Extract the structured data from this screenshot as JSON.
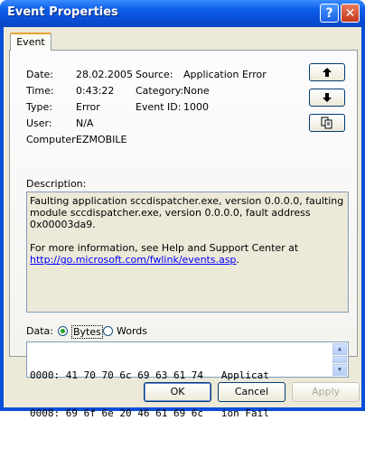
{
  "window": {
    "title": "Event Properties",
    "help_label": "?",
    "close_label": "✕"
  },
  "tab": {
    "label": "Event"
  },
  "fields": {
    "date_label": "Date:",
    "date": "28.02.2005",
    "time_label": "Time:",
    "time": "0:43:22",
    "type_label": "Type:",
    "type": "Error",
    "user_label": "User:",
    "user": "N/A",
    "computer_label": "Computer:",
    "computer": "EZMOBILE",
    "source_label": "Source:",
    "source": "Application Error",
    "category_label": "Category:",
    "category": "None",
    "eventid_label": "Event ID:",
    "eventid": "1000"
  },
  "nav": {
    "up_icon": "arrow-up-icon",
    "down_icon": "arrow-down-icon",
    "copy_icon": "copy-icon"
  },
  "description": {
    "label": "Description:",
    "line1": "Faulting application sccdispatcher.exe, version 0.0.0.0, faulting module sccdispatcher.exe, version 0.0.0.0, fault address 0x00003da9.",
    "line2": "For more information, see Help and Support Center at",
    "link": "http://go.microsoft.com/fwlink/events.asp",
    "link_suffix": "."
  },
  "data_section": {
    "label": "Data:",
    "bytes_label": "Bytes",
    "words_label": "Words",
    "selected": "Bytes",
    "rows": [
      "0000: 41 70 70 6c 69 63 61 74   Applicat",
      "0008: 69 6f 6e 20 46 61 69 6c   ion Fail"
    ]
  },
  "buttons": {
    "ok": "OK",
    "cancel": "Cancel",
    "apply": "Apply"
  }
}
